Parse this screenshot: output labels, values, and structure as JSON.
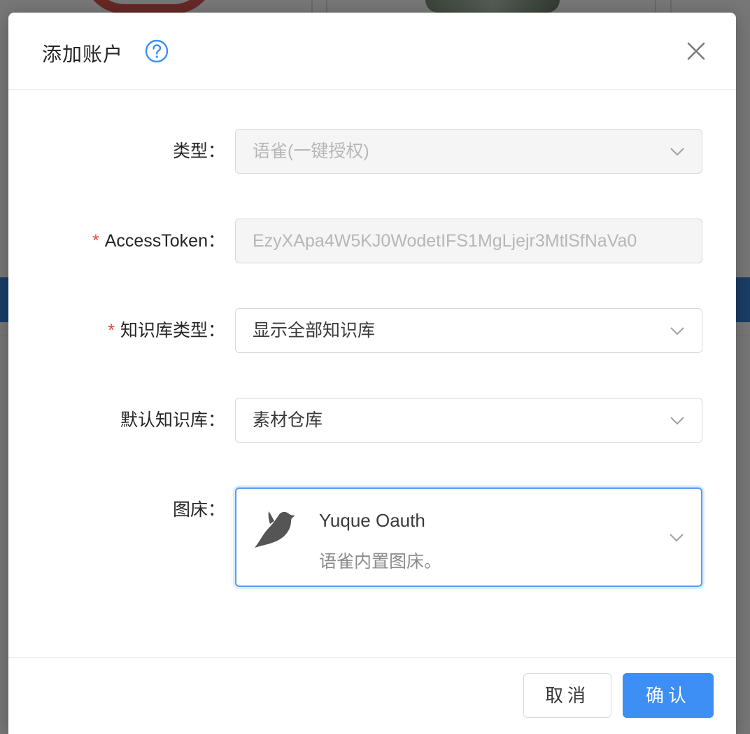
{
  "modal": {
    "title": "添加账户",
    "help_icon": "question-circle-icon",
    "close_icon": "close-icon"
  },
  "form": {
    "type": {
      "label": "类型：",
      "value": "语雀(一键授权)",
      "disabled": true
    },
    "access_token": {
      "label": "AccessToken：",
      "value": "EzyXApa4W5KJ0WodetIFS1MgLjejr3MtlSfNaVa0",
      "required": true,
      "disabled": true
    },
    "repo_type": {
      "label": "知识库类型：",
      "value": "显示全部知识库",
      "required": true
    },
    "default_repo": {
      "label": "默认知识库：",
      "value": "素材仓库"
    },
    "image_host": {
      "label": "图床：",
      "option_title": "Yuque Oauth",
      "option_desc": "语雀内置图床。",
      "option_icon": "yuque-bird-icon"
    },
    "required_mark": "*"
  },
  "footer": {
    "cancel_label": "取消",
    "ok_label": "确认"
  },
  "colors": {
    "primary": "#3d8ef5",
    "required": "#e8473b",
    "focus_border": "#5b9bf0"
  }
}
